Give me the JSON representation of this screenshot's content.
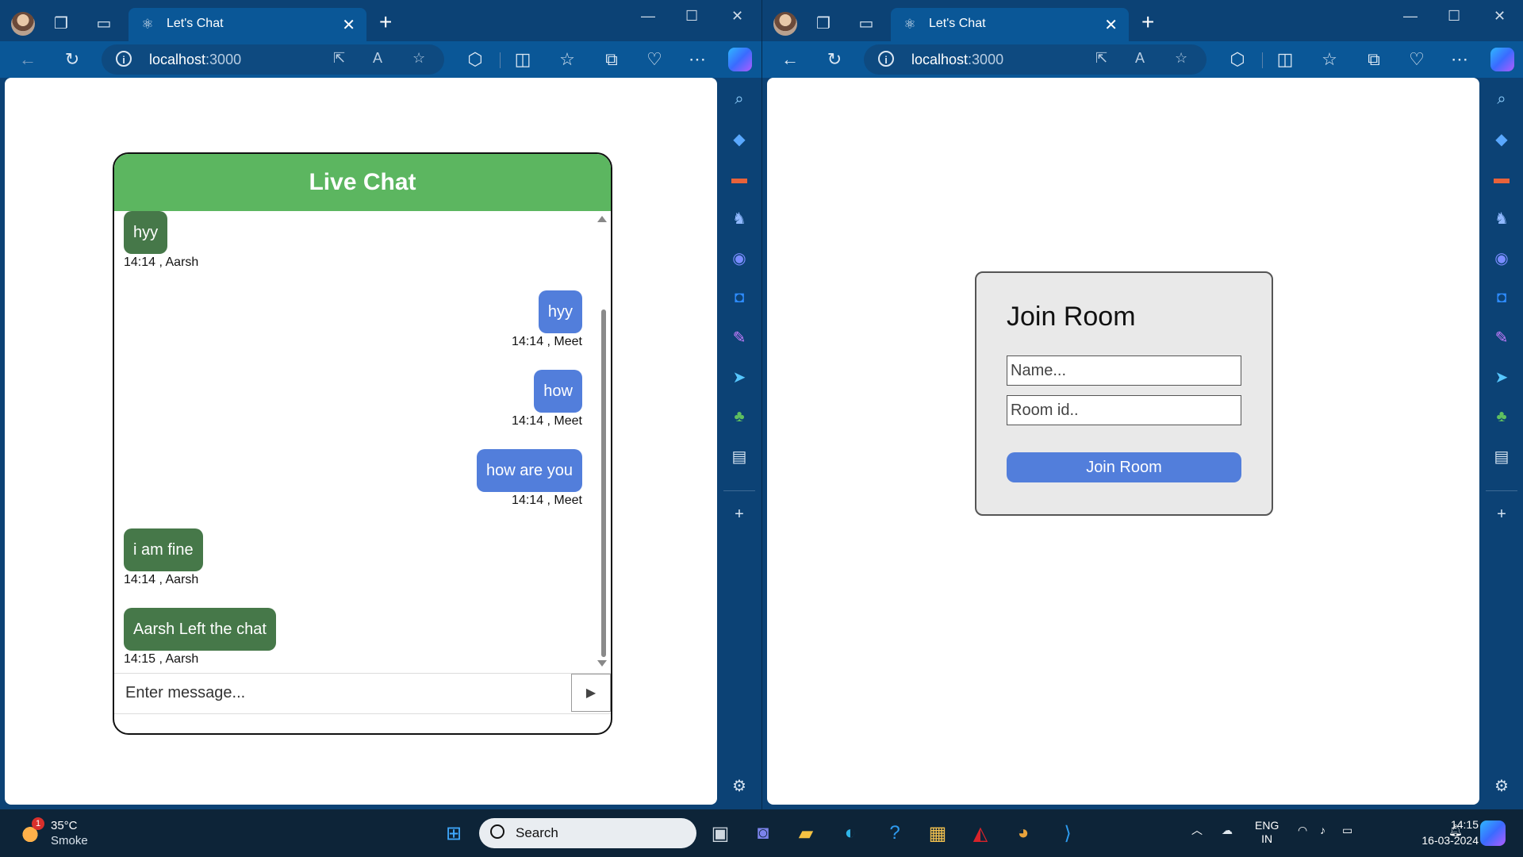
{
  "browser_left": {
    "tab_title": "Let's Chat",
    "url_host": "localhost",
    "url_port": ":3000"
  },
  "browser_right": {
    "tab_title": "Let's Chat",
    "url_host": "localhost",
    "url_port": ":3000"
  },
  "chat": {
    "header": "Live Chat",
    "messages": [
      {
        "text": "hyy",
        "meta": "14:14 , Aarsh",
        "side": "in"
      },
      {
        "text": "hyy",
        "meta": "14:14 , Meet",
        "side": "out"
      },
      {
        "text": "how",
        "meta": "14:14 , Meet",
        "side": "out"
      },
      {
        "text": "how are you",
        "meta": "14:14 , Meet",
        "side": "out"
      },
      {
        "text": "i am fine",
        "meta": "14:14 , Aarsh",
        "side": "in"
      },
      {
        "text": "Aarsh Left the chat",
        "meta": "14:15 , Aarsh",
        "side": "in"
      }
    ],
    "input_placeholder": "Enter message...",
    "send_glyph": "▶"
  },
  "join_room": {
    "title": "Join Room",
    "name_placeholder": "Name...",
    "room_placeholder": "Room id..",
    "button_label": "Join Room"
  },
  "taskbar": {
    "weather_badge": "1",
    "temperature": "35°C",
    "condition": "Smoke",
    "search_label": "Search",
    "lang_top": "ENG",
    "lang_bottom": "IN",
    "time": "14:15",
    "date": "16-03-2024"
  },
  "colors": {
    "chat_header": "#5cb660",
    "incoming_bubble": "#467849",
    "outgoing_bubble": "#527edb",
    "join_button": "#527edb",
    "browser_frame": "#0c4275"
  }
}
